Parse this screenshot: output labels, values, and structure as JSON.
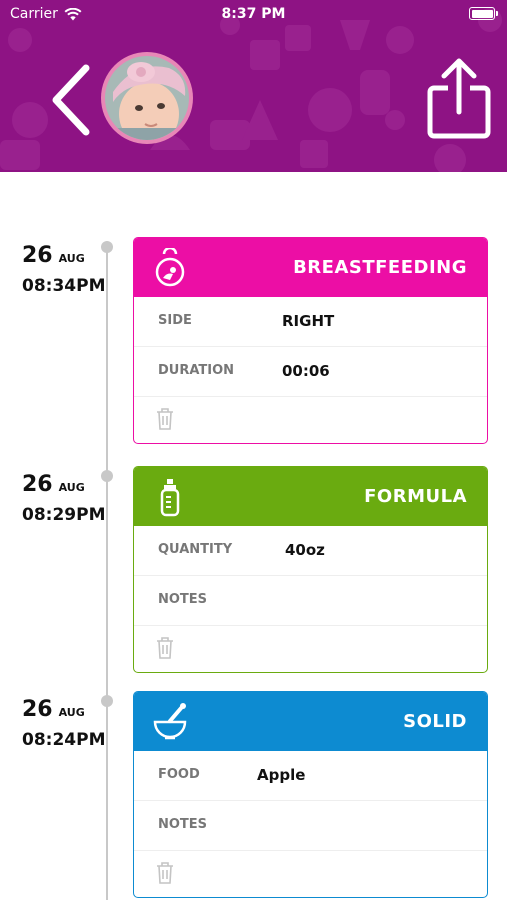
{
  "status_bar": {
    "carrier": "Carrier",
    "time": "8:37 PM"
  },
  "header": {
    "back_icon": "chevron-left-icon",
    "share_icon": "share-icon",
    "avatar": "baby-photo"
  },
  "entries": [
    {
      "day": "26",
      "month": "AUG",
      "time": "08:34PM",
      "type": "BREASTFEEDING",
      "color": "#ec0ea5",
      "icon": "breastfeeding-icon",
      "fields": [
        {
          "label": "SIDE",
          "value": "RIGHT"
        },
        {
          "label": "DURATION",
          "value": "00:06"
        }
      ]
    },
    {
      "day": "26",
      "month": "AUG",
      "time": "08:29PM",
      "type": "FORMULA",
      "color": "#6aab10",
      "icon": "bottle-icon",
      "fields": [
        {
          "label": "QUANTITY",
          "value": "40oz"
        },
        {
          "label": "NOTES",
          "value": ""
        }
      ]
    },
    {
      "day": "26",
      "month": "AUG",
      "time": "08:24PM",
      "type": "SOLID",
      "color": "#0d8bd1",
      "icon": "mortar-bowl-icon",
      "fields": [
        {
          "label": "FOOD",
          "value": "Apple"
        },
        {
          "label": "NOTES",
          "value": ""
        }
      ]
    }
  ]
}
